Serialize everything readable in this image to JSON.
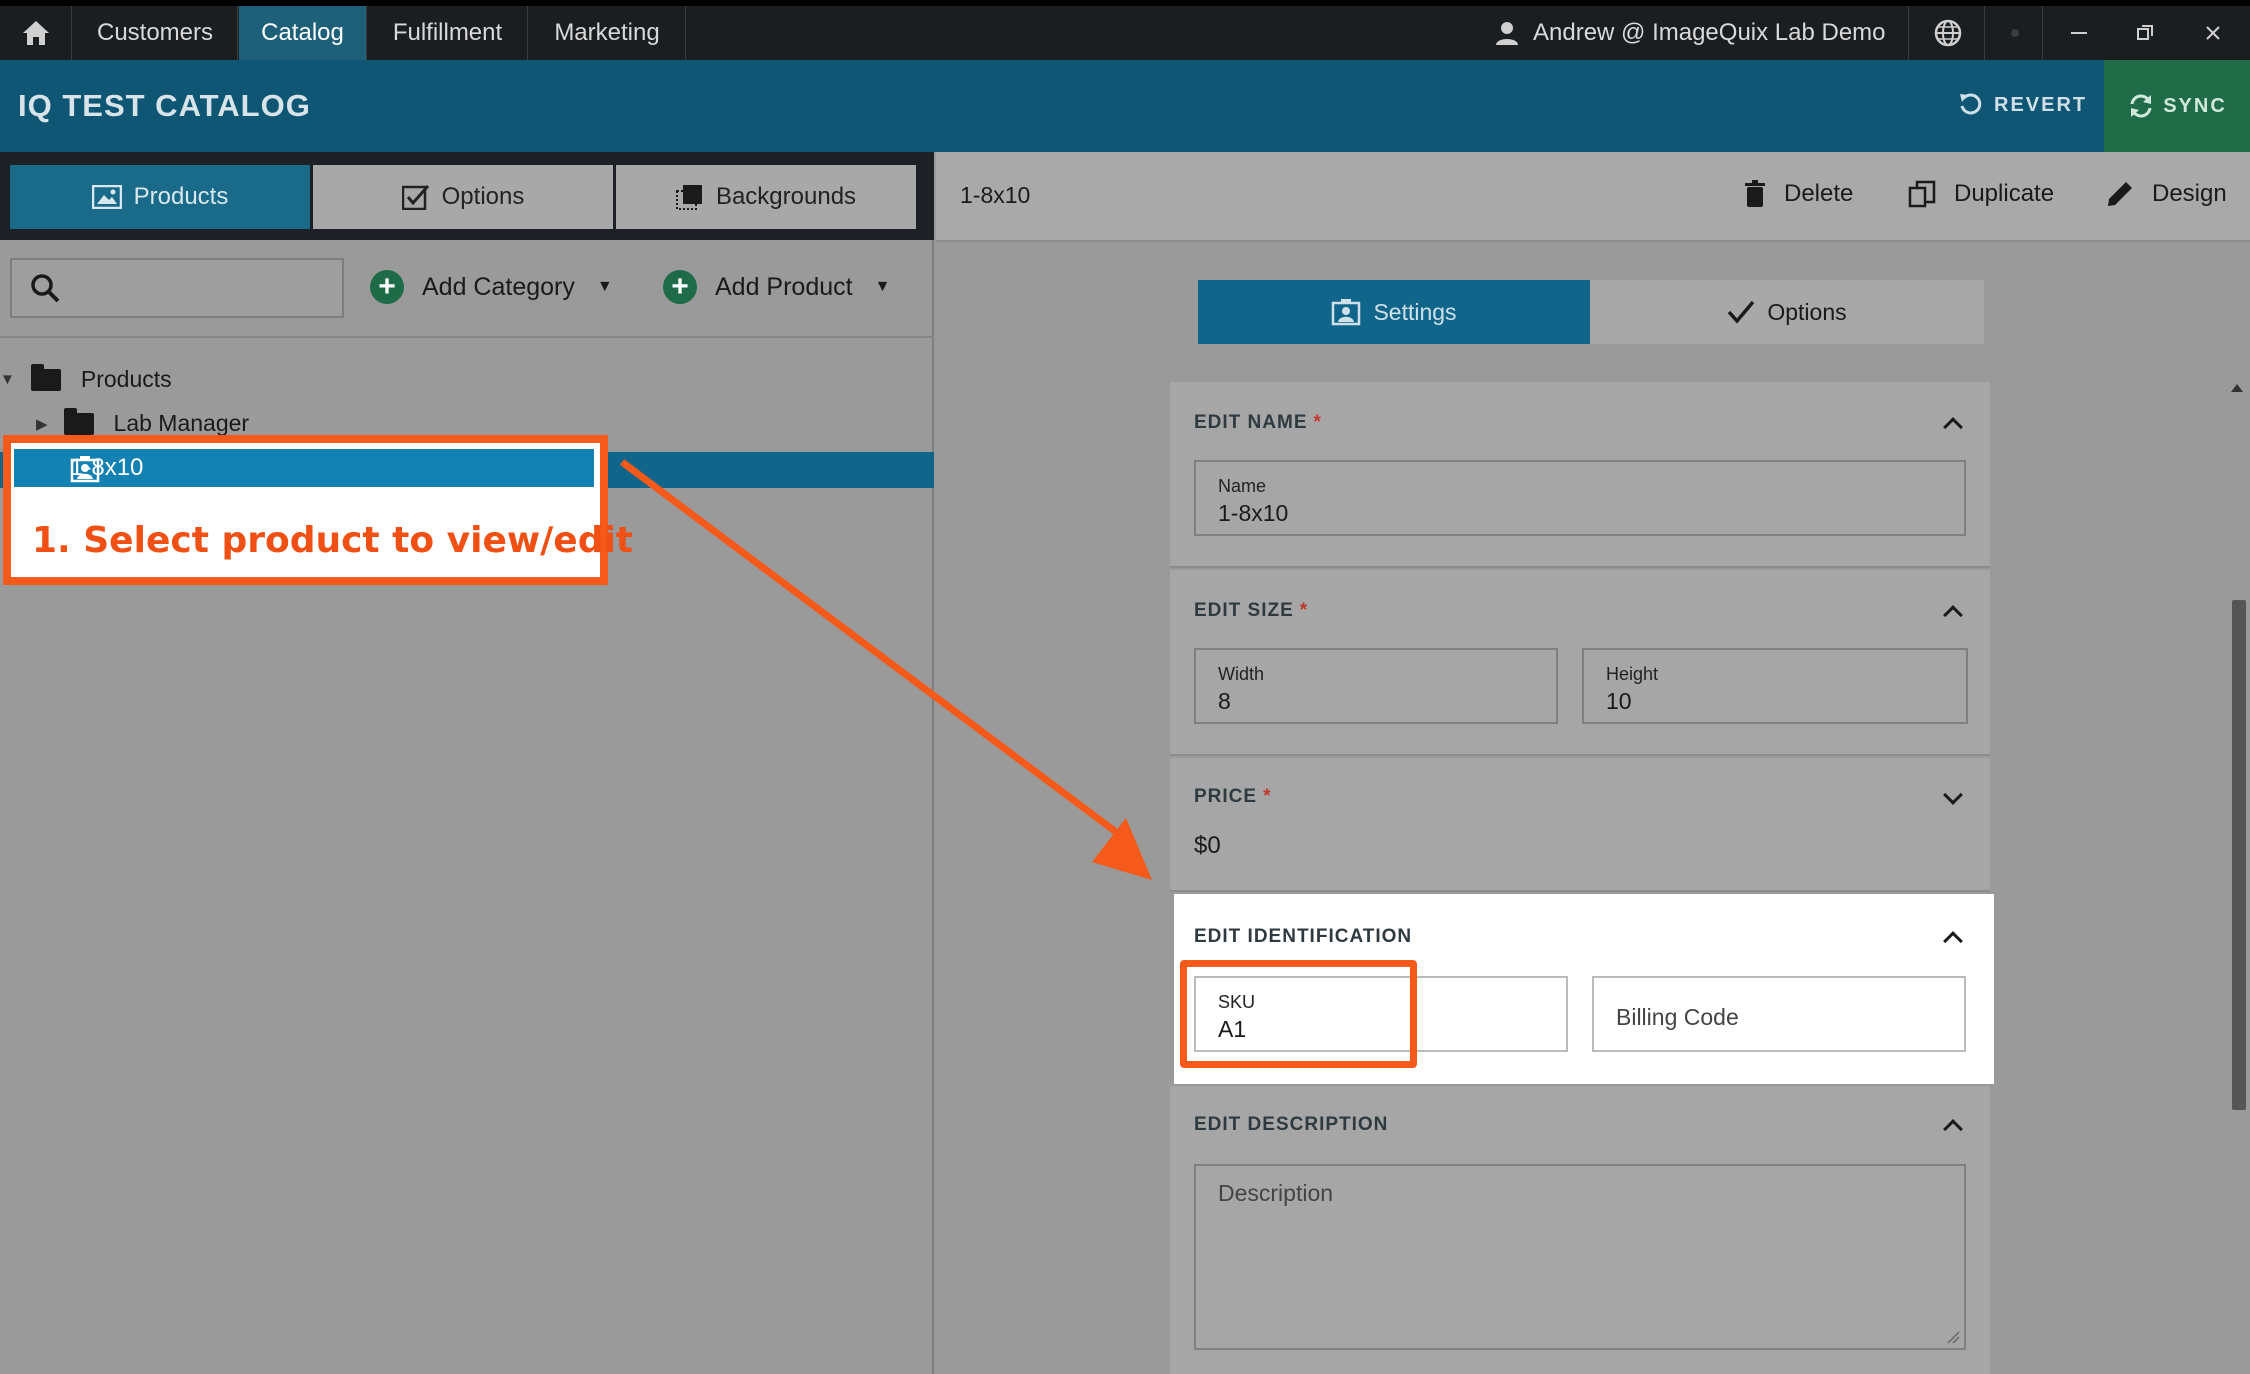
{
  "nav": {
    "tabs": [
      "Customers",
      "Catalog",
      "Fulfillment",
      "Marketing"
    ],
    "active_tab": "Catalog",
    "user": "Andrew @ ImageQuix Lab Demo"
  },
  "catalog": {
    "title": "IQ TEST CATALOG",
    "revert_label": "REVERT",
    "sync_label": "SYNC"
  },
  "left_panel": {
    "tabs": [
      "Products",
      "Options",
      "Backgrounds"
    ],
    "active_tab": "Products",
    "search_placeholder": "",
    "add_category_label": "Add Category",
    "add_product_label": "Add Product",
    "tree": {
      "root": "Products",
      "child_folder": "Lab Manager",
      "selected_item": "1-8x10"
    }
  },
  "annotation": {
    "step_text": "1. Select product to view/edit"
  },
  "right_panel": {
    "product_name": "1-8x10",
    "delete_label": "Delete",
    "duplicate_label": "Duplicate",
    "design_label": "Design",
    "segments": [
      "Settings",
      "Options"
    ],
    "active_segment": "Settings",
    "sections": {
      "name": {
        "header": "EDIT NAME",
        "required": "*",
        "field_label": "Name",
        "value": "1-8x10"
      },
      "size": {
        "header": "EDIT SIZE",
        "required": "*",
        "width_label": "Width",
        "width_value": "8",
        "height_label": "Height",
        "height_value": "10"
      },
      "price": {
        "header": "PRICE",
        "required": "*",
        "value": "$0"
      },
      "identification": {
        "header": "EDIT IDENTIFICATION",
        "sku_label": "SKU",
        "sku_value": "A1",
        "billing_placeholder": "Billing Code"
      },
      "description": {
        "header": "EDIT DESCRIPTION",
        "placeholder": "Description"
      }
    }
  },
  "colors": {
    "accent": "#1a6a8a",
    "header_bg": "#0f5674",
    "sync_bg": "#206c48",
    "annotation": "#f55a1a"
  }
}
